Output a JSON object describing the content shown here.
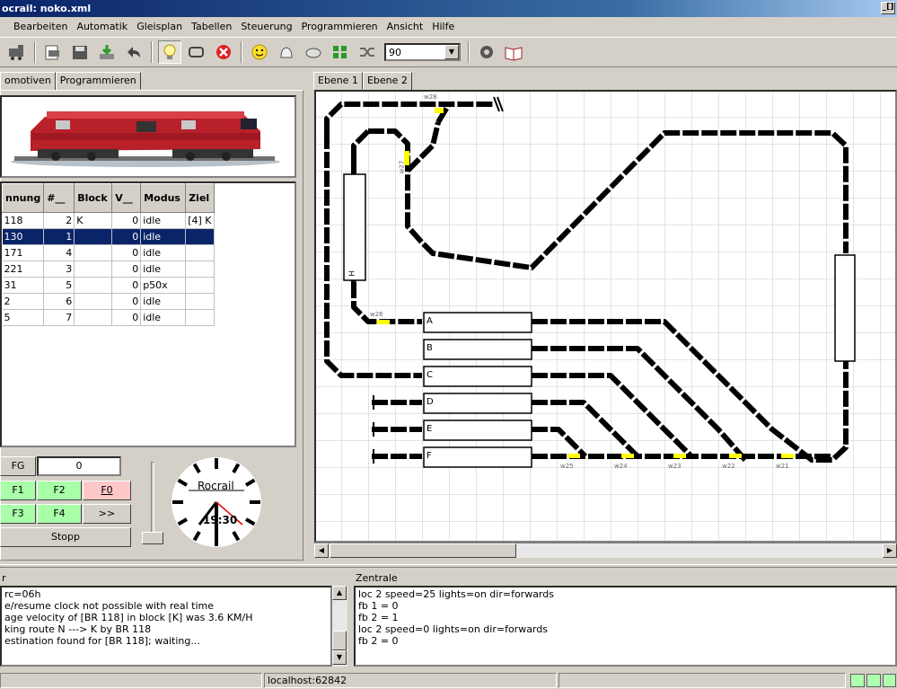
{
  "window": {
    "title": "ocrail: noko.xml",
    "ctrl_glyph": "_[]"
  },
  "menu": [
    "Bearbeiten",
    "Automatik",
    "Gleisplan",
    "Tabellen",
    "Steuerung",
    "Programmieren",
    "Ansicht",
    "Hilfe"
  ],
  "toolbar": {
    "icons": [
      "locomotive-icon",
      "locomotive-edit-icon",
      "save-icon",
      "download-icon",
      "undo-icon",
      "lightbulb-icon",
      "loop-icon",
      "stop-icon",
      "smiley-icon",
      "bell-icon",
      "cloud-icon",
      "grid-icon",
      "shuffle-icon",
      "gear-icon",
      "book-icon"
    ],
    "speed_value": "90"
  },
  "left_tabs": [
    "omotiven",
    "Programmieren"
  ],
  "loco_table": {
    "columns": [
      "nnung",
      "#__",
      "Block",
      "V__",
      "Modus",
      "Ziel"
    ],
    "rows": [
      {
        "name": "118",
        "addr": "2",
        "block": "K",
        "v": "0",
        "mode": "idle",
        "dest": "[4] K"
      },
      {
        "name": "130",
        "addr": "1",
        "block": "",
        "v": "0",
        "mode": "idle",
        "dest": ""
      },
      {
        "name": "171",
        "addr": "4",
        "block": "",
        "v": "0",
        "mode": "idle",
        "dest": ""
      },
      {
        "name": "221",
        "addr": "3",
        "block": "",
        "v": "0",
        "mode": "idle",
        "dest": ""
      },
      {
        "name": "31",
        "addr": "5",
        "block": "",
        "v": "0",
        "mode": "p50x",
        "dest": ""
      },
      {
        "name": "2",
        "addr": "6",
        "block": "",
        "v": "0",
        "mode": "idle",
        "dest": ""
      },
      {
        "name": "5",
        "addr": "7",
        "block": "",
        "v": "0",
        "mode": "idle",
        "dest": ""
      }
    ],
    "selected_row": 1
  },
  "controls": {
    "fg": "FG",
    "speed": "0",
    "f1": "F1",
    "f2": "F2",
    "f0": "F0",
    "f3": "F3",
    "f4": "F4",
    "more": ">>",
    "stop": "Stopp"
  },
  "clock": {
    "brand": "Rocrail",
    "time": "19:30"
  },
  "plan_tabs": [
    "Ebene 1",
    "Ebene 2"
  ],
  "plan": {
    "blocks": [
      "A",
      "B",
      "C",
      "D",
      "E",
      "F"
    ],
    "switches": [
      "w28",
      "w27",
      "w26",
      "w25",
      "w24",
      "w23",
      "w22",
      "w21"
    ],
    "vblock_label": "H"
  },
  "server_panel": {
    "label": "r",
    "lines": [
      " rc=06h",
      "e/resume clock not possible with real time",
      "age velocity of [BR 118] in block [K] was 3.6 KM/H",
      "king route N ---> K by BR 118",
      "estination found for [BR 118]; waiting..."
    ]
  },
  "central_panel": {
    "label": "Zentrale",
    "lines": [
      "loc 2 speed=25 lights=on dir=forwards",
      "fb 1 = 0",
      "fb 2 = 1",
      "loc 2 speed=0 lights=on dir=forwards",
      "fb 2 = 0"
    ]
  },
  "status": {
    "host": "localhost:62842"
  },
  "colors": {
    "track": "#000000",
    "sensor": "#ffff00",
    "selection": "#0a246a",
    "green_btn": "#a8ffa8"
  }
}
